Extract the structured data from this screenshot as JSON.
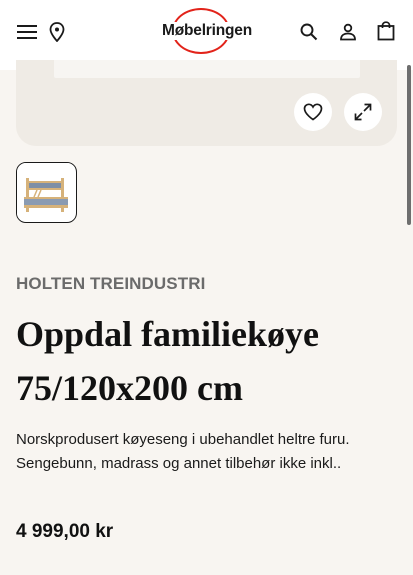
{
  "header": {
    "logo_text": "Møbelringen"
  },
  "product": {
    "brand": "HOLTEN TREINDUSTRI",
    "title": "Oppdal familiekøye 75/120x200 cm",
    "description": "Norskprodusert køyeseng i ubehandlet heltre furu. Sengebunn, madrass og annet tilbehør ikke inkl..",
    "price": "4 999,00 kr"
  },
  "icons": {
    "menu": "menu-icon",
    "location": "location-pin-icon",
    "search": "search-icon",
    "account": "user-icon",
    "cart": "shopping-bag-icon",
    "favorite": "heart-icon",
    "expand": "expand-icon"
  },
  "colors": {
    "brand_red": "#e2231a",
    "page_bg": "#f8f5f1",
    "brand_label": "#6b6b6b"
  }
}
